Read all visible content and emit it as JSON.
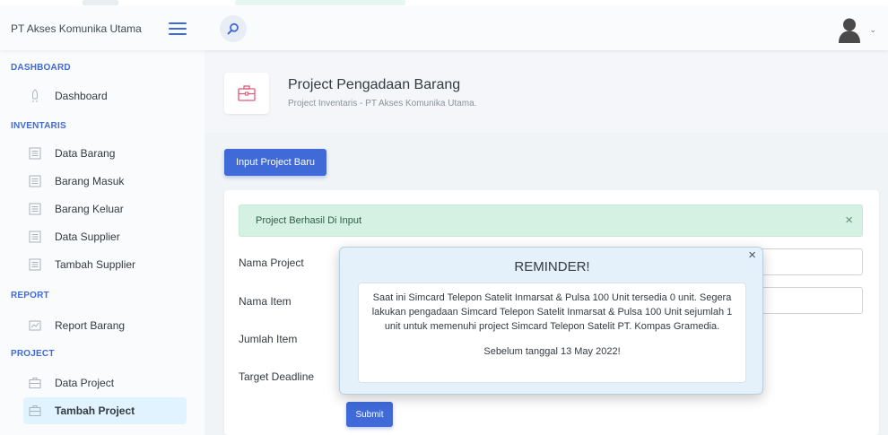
{
  "app": {
    "brand": "PT Akses Komunika Utama"
  },
  "icons": {
    "menu": "hamburger-menu-icon",
    "search": "search-icon",
    "avatar": "user-avatar-icon",
    "caret": "chevron-down-icon",
    "nav": "document-icon",
    "title": "briefcase-icon"
  },
  "colors": {
    "accent": "#3f6ad8",
    "success_bg": "#d4f1e3",
    "active_nav_bg": "#e0f3ff"
  },
  "sidebar": {
    "sections": [
      {
        "heading": "DASHBOARD",
        "items": [
          {
            "label": "Dashboard"
          }
        ]
      },
      {
        "heading": "INVENTARIS",
        "items": [
          {
            "label": "Data Barang"
          },
          {
            "label": "Barang Masuk"
          },
          {
            "label": "Barang Keluar"
          },
          {
            "label": "Data Supplier"
          },
          {
            "label": "Tambah Supplier"
          }
        ]
      },
      {
        "heading": "REPORT",
        "items": [
          {
            "label": "Report Barang"
          }
        ]
      },
      {
        "heading": "PROJECT",
        "items": [
          {
            "label": "Data Project"
          },
          {
            "label": "Tambah Project",
            "active": true
          }
        ]
      }
    ]
  },
  "page": {
    "title": "Project Pengadaan Barang",
    "subtitle": "Project Inventaris - PT Akses Komunika Utama."
  },
  "actions": {
    "input_project": "Input Project Baru"
  },
  "alert": {
    "message": "Project Berhasil Di Input",
    "close": "×"
  },
  "form": {
    "fields": [
      {
        "label": "Nama Project",
        "value": ""
      },
      {
        "label": "Nama Item",
        "value": ""
      },
      {
        "label": "Jumlah Item"
      },
      {
        "label": "Target Deadline"
      }
    ],
    "submit": "Submit"
  },
  "modal": {
    "title": "REMINDER!",
    "close": "×",
    "message": "Saat ini Simcard Telepon Satelit Inmarsat & Pulsa 100 Unit tersedia 0 unit. Segera lakukan pengadaan Simcard Telepon Satelit Inmarsat & Pulsa 100 Unit sejumlah 1 unit untuk memenuhi project Simcard Telepon Satelit PT. Kompas Gramedia.",
    "deadline": "Sebelum tanggal 13 May 2022!"
  }
}
